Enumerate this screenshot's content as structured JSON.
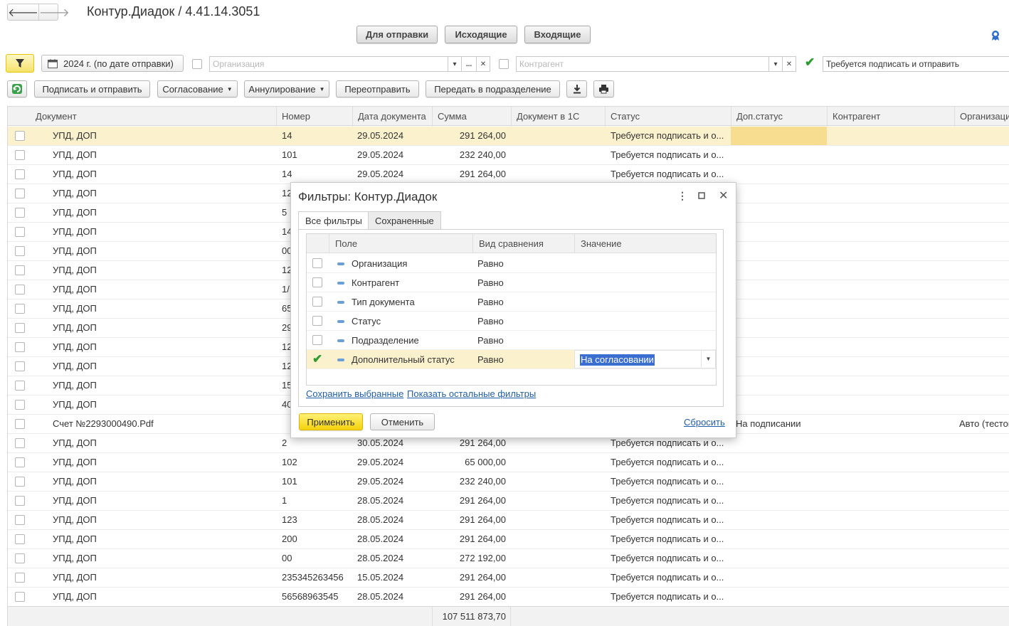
{
  "nav": {
    "back_glyph": "🡐",
    "forward_glyph": "🡒"
  },
  "title": "Контур.Диадок / 4.41.14.3051",
  "top_tabs": [
    "Для отправки",
    "Исходящие",
    "Входящие"
  ],
  "filter_bar": {
    "period": "2024 г. (по дате отправки)",
    "organization_placeholder": "Организация",
    "counterparty_placeholder": "Контрагент",
    "status_value": "Требуется подписать и отправить",
    "status_checked": true
  },
  "toolbar": {
    "sign_send": "Подписать и отправить",
    "approval": "Согласование",
    "cancellation": "Аннулирование",
    "resend": "Переотправить",
    "transfer": "Передать в подразделение"
  },
  "table": {
    "columns": [
      "Документ",
      "Номер",
      "Дата документа",
      "Сумма",
      "Документ в 1С",
      "Статус",
      "Доп.статус",
      "Контрагент",
      "Организация"
    ],
    "rows": [
      {
        "doc": "УПД, ДОП",
        "num": "14",
        "date": "29.05.2024",
        "sum": "291 264,00",
        "status": "Требуется подписать и о...",
        "extra": "",
        "org": ""
      },
      {
        "doc": "УПД, ДОП",
        "num": "101",
        "date": "29.05.2024",
        "sum": "232 240,00",
        "status": "Требуется подписать и о...",
        "extra": "",
        "org": ""
      },
      {
        "doc": "УПД, ДОП",
        "num": "14",
        "date": "29.05.2024",
        "sum": "291 264,00",
        "status": "Требуется подписать и о...",
        "extra": "",
        "org": ""
      },
      {
        "doc": "УПД, ДОП",
        "num": "12",
        "date": "",
        "sum": "",
        "status": "",
        "extra": "",
        "org": ""
      },
      {
        "doc": "УПД, ДОП",
        "num": "5",
        "date": "",
        "sum": "",
        "status": "",
        "extra": "",
        "org": ""
      },
      {
        "doc": "УПД, ДОП",
        "num": "14",
        "date": "",
        "sum": "",
        "status": "",
        "extra": "",
        "org": ""
      },
      {
        "doc": "УПД, ДОП",
        "num": "00",
        "date": "",
        "sum": "",
        "status": "",
        "extra": "",
        "org": ""
      },
      {
        "doc": "УПД, ДОП",
        "num": "12",
        "date": "",
        "sum": "",
        "status": "",
        "extra": "",
        "org": ""
      },
      {
        "doc": "УПД, ДОП",
        "num": "1/",
        "date": "",
        "sum": "",
        "status": "",
        "extra": "",
        "org": ""
      },
      {
        "doc": "УПД, ДОП",
        "num": "65",
        "date": "",
        "sum": "",
        "status": "",
        "extra": "",
        "org": ""
      },
      {
        "doc": "УПД, ДОП",
        "num": "29",
        "date": "",
        "sum": "",
        "status": "",
        "extra": "",
        "org": ""
      },
      {
        "doc": "УПД, ДОП",
        "num": "12",
        "date": "",
        "sum": "",
        "status": "",
        "extra": "",
        "org": ""
      },
      {
        "doc": "УПД, ДОП",
        "num": "12",
        "date": "",
        "sum": "",
        "status": "",
        "extra": "",
        "org": ""
      },
      {
        "doc": "УПД, ДОП",
        "num": "15",
        "date": "",
        "sum": "",
        "status": "",
        "extra": "",
        "org": ""
      },
      {
        "doc": "УПД, ДОП",
        "num": "40",
        "date": "",
        "sum": "",
        "status": "",
        "extra": "",
        "org": ""
      },
      {
        "doc": "Счет №2293000490.Pdf",
        "num": "",
        "date": "",
        "sum": "",
        "status": "",
        "extra": "На подписании",
        "org": "Авто (тестов"
      },
      {
        "doc": "УПД, ДОП",
        "num": "2",
        "date": "30.05.2024",
        "sum": "291 264,00",
        "status": "Требуется подписать и о...",
        "extra": "",
        "org": ""
      },
      {
        "doc": "УПД, ДОП",
        "num": "102",
        "date": "29.05.2024",
        "sum": "65 000,00",
        "status": "Требуется подписать и о...",
        "extra": "",
        "org": ""
      },
      {
        "doc": "УПД, ДОП",
        "num": "101",
        "date": "29.05.2024",
        "sum": "232 240,00",
        "status": "Требуется подписать и о...",
        "extra": "",
        "org": ""
      },
      {
        "doc": "УПД, ДОП",
        "num": "1",
        "date": "28.05.2024",
        "sum": "291 264,00",
        "status": "Требуется подписать и о...",
        "extra": "",
        "org": ""
      },
      {
        "doc": "УПД, ДОП",
        "num": "123",
        "date": "28.05.2024",
        "sum": "291 264,00",
        "status": "Требуется подписать и о...",
        "extra": "",
        "org": ""
      },
      {
        "doc": "УПД, ДОП",
        "num": "200",
        "date": "28.05.2024",
        "sum": "291 264,00",
        "status": "Требуется подписать и о...",
        "extra": "",
        "org": ""
      },
      {
        "doc": "УПД, ДОП",
        "num": "00",
        "date": "28.05.2024",
        "sum": "272 192,00",
        "status": "Требуется подписать и о...",
        "extra": "",
        "org": ""
      },
      {
        "doc": "УПД, ДОП",
        "num": "235345263456",
        "date": "15.05.2024",
        "sum": "291 264,00",
        "status": "Требуется подписать и о...",
        "extra": "",
        "org": ""
      },
      {
        "doc": "УПД, ДОП",
        "num": "56568963545",
        "date": "28.05.2024",
        "sum": "291 264,00",
        "status": "Требуется подписать и о...",
        "extra": "",
        "org": ""
      }
    ],
    "total_sum": "107 511 873,70"
  },
  "dialog": {
    "title": "Фильтры: Контур.Диадок",
    "tabs": [
      "Все фильтры",
      "Сохраненные"
    ],
    "columns": [
      "Поле",
      "Вид сравнения",
      "Значение"
    ],
    "rows": [
      {
        "field": "Организация",
        "comparison": "Равно",
        "checked": false,
        "value": ""
      },
      {
        "field": "Контрагент",
        "comparison": "Равно",
        "checked": false,
        "value": ""
      },
      {
        "field": "Тип документа",
        "comparison": "Равно",
        "checked": false,
        "value": ""
      },
      {
        "field": "Статус",
        "comparison": "Равно",
        "checked": false,
        "value": ""
      },
      {
        "field": "Подразделение",
        "comparison": "Равно",
        "checked": false,
        "value": ""
      },
      {
        "field": "Дополнительный статус",
        "comparison": "Равно",
        "checked": true,
        "value": "На согласовании"
      }
    ],
    "save_selected_link": "Сохранить выбранные",
    "show_other_link": "Показать остальные фильтры",
    "apply": "Применить",
    "cancel": "Отменить",
    "reset": "Сбросить"
  },
  "colors": {
    "selected_row": "#fbf2cd",
    "accent_yellow": "#f5d20c",
    "link_blue": "#1f5ea8",
    "check_green": "#2e9b2e"
  }
}
